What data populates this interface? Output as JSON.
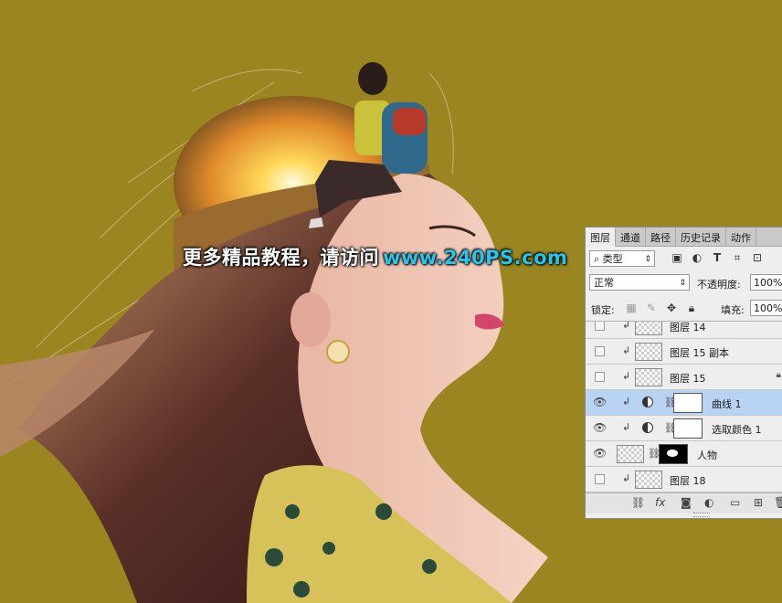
{
  "watermark": {
    "text": "更多精品教程，请访问",
    "url": "www.240PS.com"
  },
  "panel": {
    "tabs": [
      "图层",
      "通道",
      "路径",
      "历史记录",
      "动作"
    ],
    "filter": {
      "icon": "search-icon",
      "value": "类型"
    },
    "blend_mode": "正常",
    "opacity_label": "不透明度:",
    "opacity_value": "100%",
    "lock_label": "锁定:",
    "fill_label": "填充:",
    "fill_value": "100%",
    "layers": [
      {
        "name": "图层 14",
        "visible": false,
        "clipped": true
      },
      {
        "name": "图层 15 副本",
        "visible": false,
        "clipped": true
      },
      {
        "name": "图层 15",
        "visible": false,
        "clipped": true,
        "locked": true
      },
      {
        "name": "曲线 1",
        "visible": true,
        "clipped": true,
        "selected": true,
        "type": "adjustment"
      },
      {
        "name": "选取颜色 1",
        "visible": true,
        "clipped": true,
        "type": "adjustment"
      },
      {
        "name": "人物",
        "visible": true,
        "type": "smart-object-masked"
      },
      {
        "name": "图层 18",
        "visible": false,
        "clipped": true
      }
    ]
  },
  "colors": {
    "background": "#9a8520",
    "selected_row": "#b9d3f5",
    "watermark_url": "#26c5ee"
  }
}
